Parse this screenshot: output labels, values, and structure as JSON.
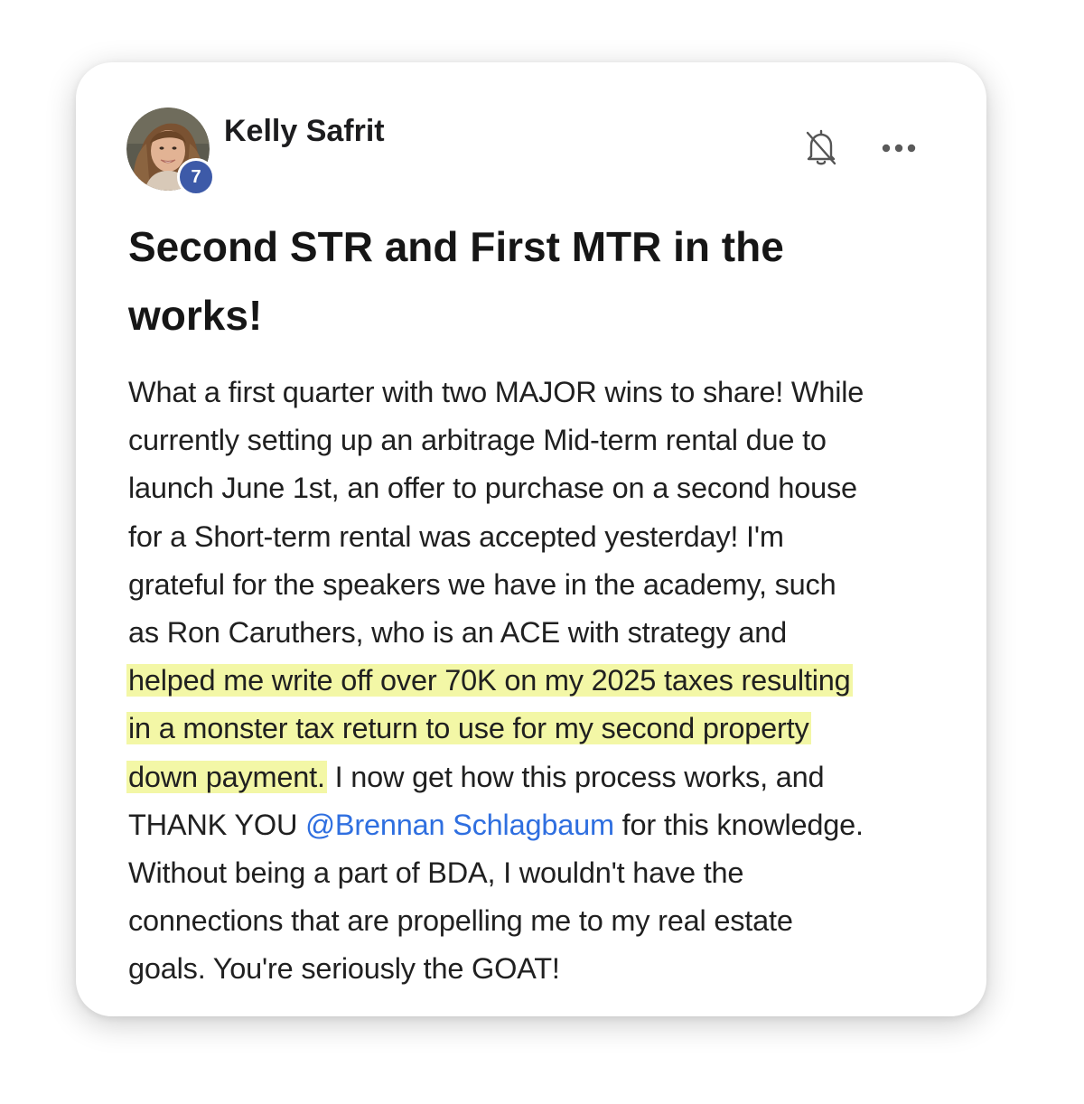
{
  "post": {
    "author": {
      "name": "Kelly Safrit",
      "level": "7",
      "avatar_icon": "user-avatar-photo",
      "level_badge_color": "#3d5aa8"
    },
    "actions": {
      "notify_icon": "bell-muted-icon",
      "more_icon": "ellipsis-icon"
    },
    "title": "Second STR and First MTR in the works!",
    "body": {
      "line1": "What a first quarter with two MAJOR wins to share! While",
      "line2": "currently setting up an arbitrage Mid-term rental due to",
      "line3": "launch June 1st, an offer to purchase on a second house",
      "line4": "for a Short-term rental was accepted yesterday! I'm",
      "line5": "grateful for the speakers we have in the academy, such",
      "line6": "as Ron Caruthers, who is an ACE with strategy and",
      "highlight1": "helped me write off over 70K on my 2025 taxes resulting",
      "highlight2": "in a monster tax return to use for my second property",
      "highlight3": "down payment.",
      "line9_rest": " I now get how this process works, and",
      "line10_pre": "THANK YOU ",
      "mention": "@Brennan Schlagbaum",
      "line10_post": " for this knowledge.",
      "line11": "Without being a part of BDA, I wouldn't have the",
      "line12": "connections that are propelling me to my real estate",
      "line13": "goals. You're seriously the GOAT!"
    },
    "colors": {
      "highlight": "#f3f7a6",
      "mention": "#2f6fe0"
    }
  }
}
